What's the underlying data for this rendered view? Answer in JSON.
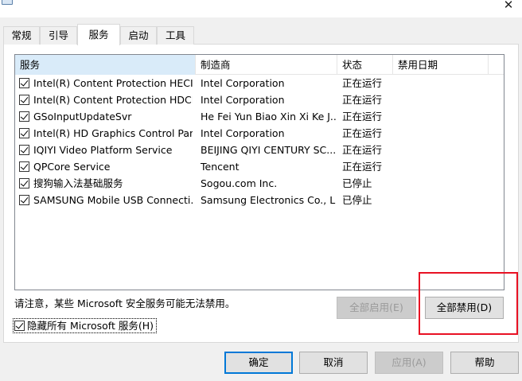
{
  "window": {
    "close_glyph": "✕"
  },
  "tabs": [
    {
      "label": "常规",
      "active": false
    },
    {
      "label": "引导",
      "active": false
    },
    {
      "label": "服务",
      "active": true
    },
    {
      "label": "启动",
      "active": false
    },
    {
      "label": "工具",
      "active": false
    }
  ],
  "columns": {
    "service": "服务",
    "manufacturer": "制造商",
    "status": "状态",
    "disabled_date": "禁用日期"
  },
  "services": [
    {
      "name": "Intel(R) Content Protection HECI ...",
      "manufacturer": "Intel Corporation",
      "status": "正在运行",
      "date": "",
      "checked": true
    },
    {
      "name": "Intel(R) Content Protection HDCP...",
      "manufacturer": "Intel Corporation",
      "status": "正在运行",
      "date": "",
      "checked": true
    },
    {
      "name": "GSoInputUpdateSvr",
      "manufacturer": "He Fei Yun Biao Xin Xi Ke J...",
      "status": "正在运行",
      "date": "",
      "checked": true
    },
    {
      "name": "Intel(R) HD Graphics Control Pan...",
      "manufacturer": "Intel Corporation",
      "status": "正在运行",
      "date": "",
      "checked": true
    },
    {
      "name": "IQIYI Video Platform Service",
      "manufacturer": "BEIJING QIYI CENTURY SC...",
      "status": "正在运行",
      "date": "",
      "checked": true
    },
    {
      "name": "QPCore Service",
      "manufacturer": "Tencent",
      "status": "正在运行",
      "date": "",
      "checked": true
    },
    {
      "name": "搜狗输入法基础服务",
      "manufacturer": "Sogou.com Inc.",
      "status": "已停止",
      "date": "",
      "checked": true
    },
    {
      "name": "SAMSUNG Mobile USB Connecti...",
      "manufacturer": "Samsung Electronics Co., L...",
      "status": "已停止",
      "date": "",
      "checked": true
    }
  ],
  "note": "请注意，某些 Microsoft 安全服务可能无法禁用。",
  "enable_all": "全部启用(E)",
  "disable_all": "全部禁用(D)",
  "hide_ms_label": "隐藏所有 Microsoft 服务(H)",
  "hide_ms_checked": true,
  "buttons": {
    "ok": "确定",
    "cancel": "取消",
    "apply": "应用(A)",
    "help": "帮助"
  },
  "colors": {
    "highlight": "#e81123",
    "selected_header": "#d9ebf9",
    "focus_border": "#0078d7"
  }
}
